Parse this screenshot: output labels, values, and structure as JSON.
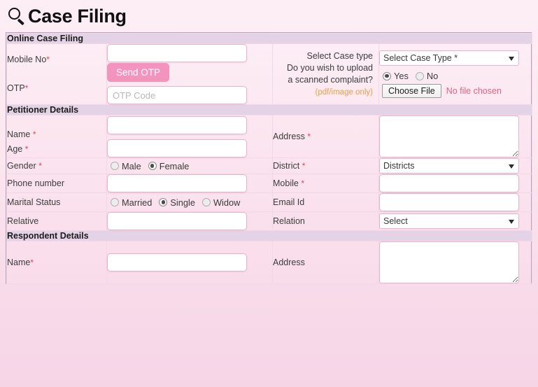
{
  "page": {
    "title": "Case Filing",
    "title_icon": "search-icon"
  },
  "sections": {
    "online_case_filing": {
      "heading": "Online Case Filing",
      "mobile_label": "Mobile No",
      "mobile_required": "*",
      "mobile_value": "",
      "otp_label": "OTP",
      "otp_required": "*",
      "send_otp_label": "Send OTP",
      "otp_placeholder": "OTP Code",
      "otp_value": "",
      "case_type_label": "Select Case type",
      "upload_question_line1": "Do you wish to upload",
      "upload_question_line2": "a scanned complaint?",
      "upload_note": "(pdf/image only)",
      "case_type_selected": "Select Case Type *",
      "upload_yes_label": "Yes",
      "upload_no_label": "No",
      "upload_selected": "Yes",
      "choose_file_label": "Choose File",
      "file_status": "No file chosen"
    },
    "petitioner": {
      "heading": "Petitioner Details",
      "name_label": "Name",
      "name_required": "*",
      "name_value": "",
      "age_label": "Age",
      "age_required": "*",
      "age_value": "",
      "address_label": "Address",
      "address_required": "*",
      "address_value": "",
      "gender_label": "Gender",
      "gender_required": "*",
      "gender_male_label": "Male",
      "gender_female_label": "Female",
      "gender_selected": "Female",
      "district_label": "District",
      "district_required": "*",
      "district_selected": "Districts",
      "phone_label": "Phone number",
      "phone_value": "",
      "mobile_label": "Mobile",
      "mobile_required": "*",
      "mobile_value": "",
      "marital_label": "Marital Status",
      "marital_married_label": "Married",
      "marital_single_label": "Single",
      "marital_widow_label": "Widow",
      "marital_selected": "Single",
      "email_label": "Email Id",
      "email_value": "",
      "relative_label": "Relative",
      "relative_value": "",
      "relation_label": "Relation",
      "relation_selected": "Select"
    },
    "respondent": {
      "heading": "Respondent Details",
      "name_label": "Name",
      "name_required": "*",
      "name_value": "",
      "address_label": "Address",
      "address_value": ""
    }
  },
  "colors": {
    "accent_pink": "#f394bf",
    "section_header": "#e4d3e6",
    "required_red": "#e0445e",
    "note_orange": "#e5a24a",
    "file_status_red": "#e8607e",
    "page_background": "#fce7f0"
  }
}
